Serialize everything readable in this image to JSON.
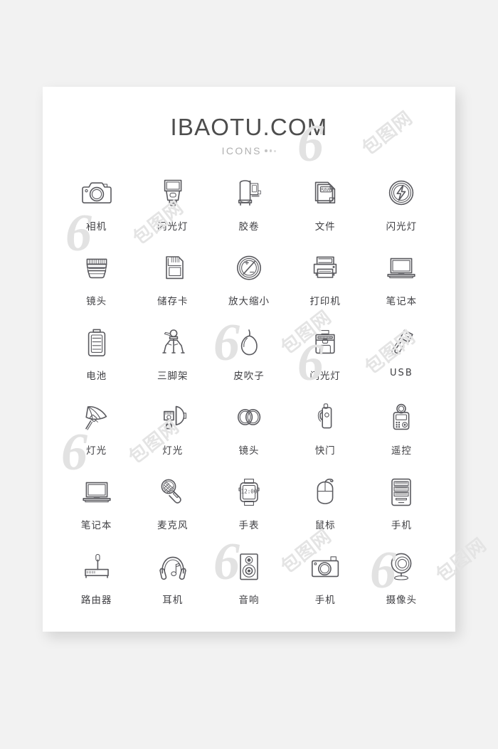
{
  "page": {
    "background_color": "#f2f2f2",
    "card_color": "#ffffff"
  },
  "watermark": {
    "digit": "6",
    "text": "包图网"
  },
  "header": {
    "title": "IBAOTU.COM",
    "subtitle": "ICONS",
    "title_color": "#4d4d4d",
    "subtitle_color": "#b0b0b0",
    "dot_count": 3
  },
  "grid": {
    "columns": 5,
    "rows": 6,
    "icon_stroke_color": "#5a5a5f",
    "label_color": "#3e3e42",
    "items": [
      {
        "label": "相机",
        "icon": "camera-icon"
      },
      {
        "label": "闪光灯",
        "icon": "flash-speedlight-icon"
      },
      {
        "label": "胶卷",
        "icon": "film-roll-icon"
      },
      {
        "label": "文件",
        "icon": "raw-file-icon",
        "badge": "RAW"
      },
      {
        "label": "闪光灯",
        "icon": "flash-circle-icon"
      },
      {
        "label": "镜头",
        "icon": "lens-icon"
      },
      {
        "label": "储存卡",
        "icon": "memory-card-icon"
      },
      {
        "label": "放大缩小",
        "icon": "zoom-in-out-icon"
      },
      {
        "label": "打印机",
        "icon": "printer-icon"
      },
      {
        "label": "笔记本",
        "icon": "laptop-icon"
      },
      {
        "label": "电池",
        "icon": "battery-icon"
      },
      {
        "label": "三脚架",
        "icon": "tripod-icon"
      },
      {
        "label": "皮吹子",
        "icon": "air-blower-icon"
      },
      {
        "label": "闪光灯",
        "icon": "camera-bag-icon"
      },
      {
        "label": "USB",
        "icon": "usb-drive-icon",
        "latin": true
      },
      {
        "label": "灯光",
        "icon": "umbrella-light-icon"
      },
      {
        "label": "灯光",
        "icon": "studio-light-icon"
      },
      {
        "label": "镜头",
        "icon": "filter-rings-icon"
      },
      {
        "label": "快门",
        "icon": "shutter-release-icon"
      },
      {
        "label": "遥控",
        "icon": "remote-control-icon"
      },
      {
        "label": "笔记本",
        "icon": "laptop-icon"
      },
      {
        "label": "麦克风",
        "icon": "microphone-icon"
      },
      {
        "label": "手表",
        "icon": "smart-watch-icon",
        "badge": "12:00"
      },
      {
        "label": "鼠标",
        "icon": "mouse-icon"
      },
      {
        "label": "手机",
        "icon": "phone-icon"
      },
      {
        "label": "路由器",
        "icon": "router-icon"
      },
      {
        "label": "耳机",
        "icon": "headphones-icon"
      },
      {
        "label": "音响",
        "icon": "speaker-icon"
      },
      {
        "label": "手机",
        "icon": "compact-camera-icon"
      },
      {
        "label": "摄像头",
        "icon": "webcam-icon"
      }
    ]
  }
}
